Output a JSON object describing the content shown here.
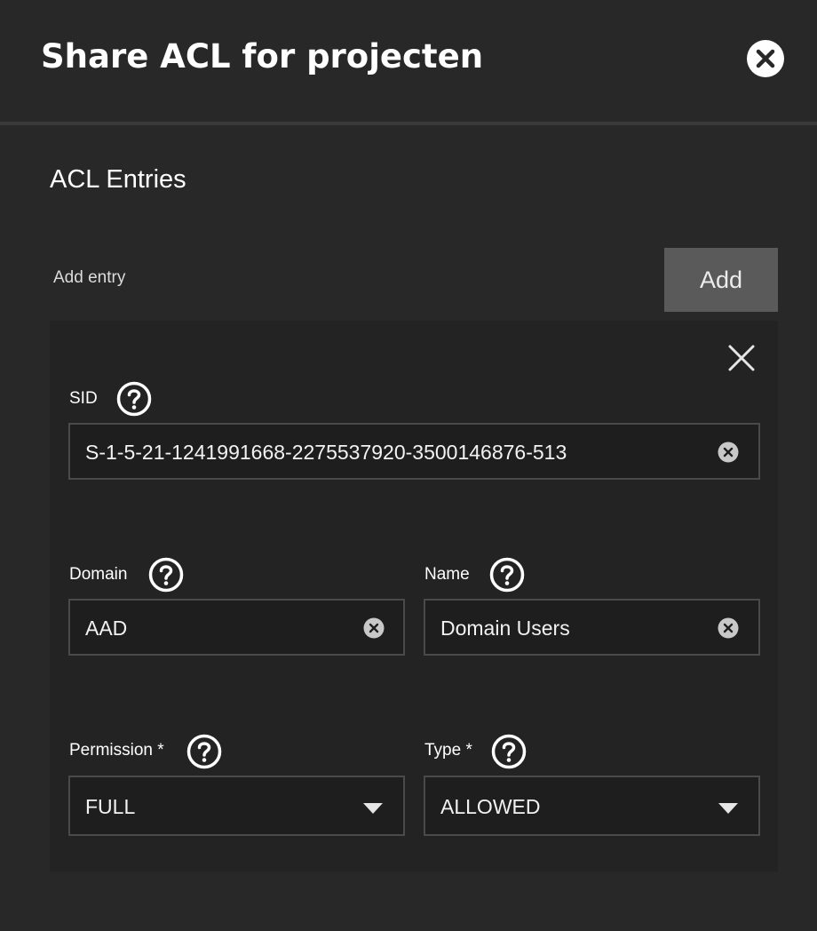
{
  "dialog": {
    "title": "Share ACL for projecten",
    "close_icon": "close-circle-icon"
  },
  "acl": {
    "section_title": "ACL Entries",
    "add_entry_label": "Add entry",
    "add_button_label": "Add",
    "entry": {
      "remove_icon": "close-icon",
      "sid": {
        "label": "SID",
        "value": "S-1-5-21-1241991668-2275537920-3500146876-513"
      },
      "domain": {
        "label": "Domain",
        "value": "AAD"
      },
      "name": {
        "label": "Name",
        "value": "Domain Users"
      },
      "permission": {
        "label": "Permission *",
        "value": "FULL"
      },
      "type": {
        "label": "Type *",
        "value": "ALLOWED"
      }
    }
  },
  "colors": {
    "background": "#282828",
    "card": "#232323",
    "input_bg": "#1e1e1e",
    "input_border": "#4a4a4a",
    "add_button": "#5a5a5a"
  }
}
